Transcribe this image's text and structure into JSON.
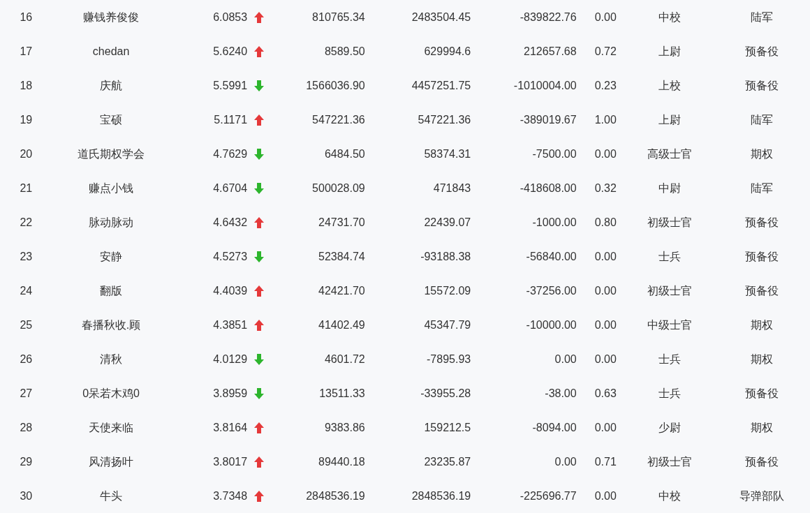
{
  "rows": [
    {
      "column_1": "16",
      "column_2": "赚钱养俊俊",
      "column_3": "6.0853",
      "rising": true,
      "column_4": "810765.34",
      "column_5": "2483504.45",
      "column_6": "-839822.76",
      "column_7": "0.00",
      "column_8": "中校",
      "column_9": "陆军"
    },
    {
      "column_1": "17",
      "column_2": "chedan",
      "column_3": "5.6240",
      "rising": true,
      "column_4": "8589.50",
      "column_5": "629994.6",
      "column_6": "212657.68",
      "column_7": "0.72",
      "column_8": "上尉",
      "column_9": "预备役"
    },
    {
      "column_1": "18",
      "column_2": "庆航",
      "column_3": "5.5991",
      "rising": false,
      "column_4": "1566036.90",
      "column_5": "4457251.75",
      "column_6": "-1010004.00",
      "column_7": "0.23",
      "column_8": "上校",
      "column_9": "预备役"
    },
    {
      "column_1": "19",
      "column_2": "宝硕",
      "column_3": "5.1171",
      "rising": true,
      "column_4": "547221.36",
      "column_5": "547221.36",
      "column_6": "-389019.67",
      "column_7": "1.00",
      "column_8": "上尉",
      "column_9": "陆军"
    },
    {
      "column_1": "20",
      "column_2": "道氏期权学会",
      "column_3": "4.7629",
      "rising": false,
      "column_4": "6484.50",
      "column_5": "58374.31",
      "column_6": "-7500.00",
      "column_7": "0.00",
      "column_8": "高级士官",
      "column_9": "期权"
    },
    {
      "column_1": "21",
      "column_2": "赚点小钱",
      "column_3": "4.6704",
      "rising": false,
      "column_4": "500028.09",
      "column_5": "471843",
      "column_6": "-418608.00",
      "column_7": "0.32",
      "column_8": "中尉",
      "column_9": "陆军"
    },
    {
      "column_1": "22",
      "column_2": "脉动脉动",
      "column_3": "4.6432",
      "rising": true,
      "column_4": "24731.70",
      "column_5": "22439.07",
      "column_6": "-1000.00",
      "column_7": "0.80",
      "column_8": "初级士官",
      "column_9": "预备役"
    },
    {
      "column_1": "23",
      "column_2": "安静",
      "column_3": "4.5273",
      "rising": false,
      "column_4": "52384.74",
      "column_5": "-93188.38",
      "column_6": "-56840.00",
      "column_7": "0.00",
      "column_8": "士兵",
      "column_9": "预备役"
    },
    {
      "column_1": "24",
      "column_2": "翻版",
      "column_3": "4.4039",
      "rising": true,
      "column_4": "42421.70",
      "column_5": "15572.09",
      "column_6": "-37256.00",
      "column_7": "0.00",
      "column_8": "初级士官",
      "column_9": "预备役"
    },
    {
      "column_1": "25",
      "column_2": "春播秋收.顾",
      "column_3": "4.3851",
      "rising": true,
      "column_4": "41402.49",
      "column_5": "45347.79",
      "column_6": "-10000.00",
      "column_7": "0.00",
      "column_8": "中级士官",
      "column_9": "期权"
    },
    {
      "column_1": "26",
      "column_2": "清秋",
      "column_3": "4.0129",
      "rising": false,
      "column_4": "4601.72",
      "column_5": "-7895.93",
      "column_6": "0.00",
      "column_7": "0.00",
      "column_8": "士兵",
      "column_9": "期权"
    },
    {
      "column_1": "27",
      "column_2": "0呆若木鸡0",
      "column_3": "3.8959",
      "rising": false,
      "column_4": "13511.33",
      "column_5": "-33955.28",
      "column_6": "-38.00",
      "column_7": "0.63",
      "column_8": "士兵",
      "column_9": "预备役"
    },
    {
      "column_1": "28",
      "column_2": "天使来临",
      "column_3": "3.8164",
      "rising": true,
      "column_4": "9383.86",
      "column_5": "159212.5",
      "column_6": "-8094.00",
      "column_7": "0.00",
      "column_8": "少尉",
      "column_9": "期权"
    },
    {
      "column_1": "29",
      "column_2": "风清扬叶",
      "column_3": "3.8017",
      "rising": true,
      "column_4": "89440.18",
      "column_5": "23235.87",
      "column_6": "0.00",
      "column_7": "0.71",
      "column_8": "初级士官",
      "column_9": "预备役"
    },
    {
      "column_1": "30",
      "column_2": "牛头",
      "column_3": "3.7348",
      "rising": true,
      "column_4": "2848536.19",
      "column_5": "2848536.19",
      "column_6": "-225696.77",
      "column_7": "0.00",
      "column_8": "中校",
      "column_9": "导弹部队"
    }
  ]
}
